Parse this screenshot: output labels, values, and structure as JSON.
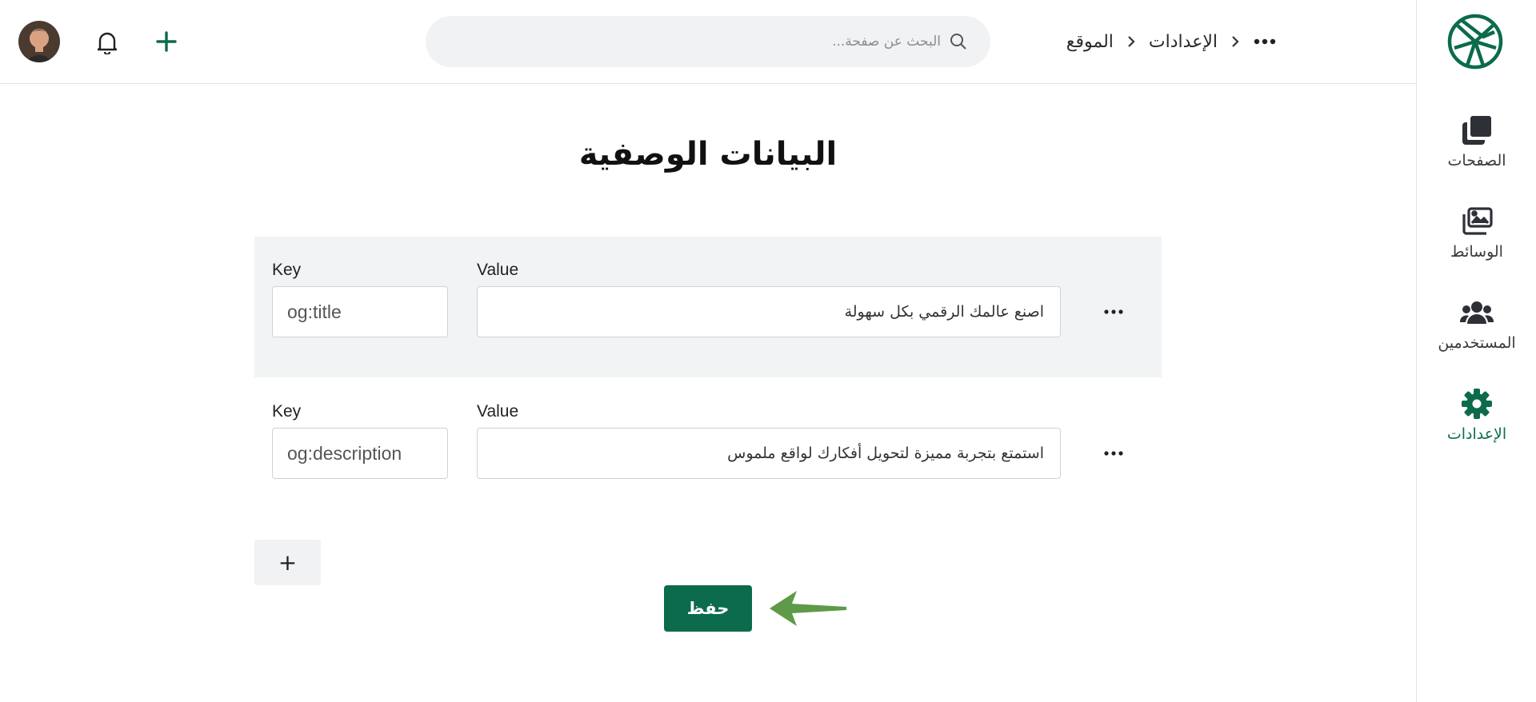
{
  "header": {
    "search_placeholder": "البحث عن صفحة...",
    "breadcrumb": [
      "الإعدادات",
      "الموقع"
    ],
    "icons": {
      "search": "search-icon",
      "bell": "bell-icon",
      "add": "plus-icon",
      "more": "more-horizontal-icon",
      "chevron": "chevron-right-icon"
    }
  },
  "sidebar": {
    "items": [
      {
        "label": "الصفحات",
        "icon": "pages-icon",
        "active": false
      },
      {
        "label": "الوسائط",
        "icon": "media-icon",
        "active": false
      },
      {
        "label": "المستخدمين",
        "icon": "users-icon",
        "active": false
      },
      {
        "label": "الإعدادات",
        "icon": "gear-icon",
        "active": true
      }
    ]
  },
  "main": {
    "title": "البيانات الوصفية",
    "rows": [
      {
        "key_label": "Key",
        "value_label": "Value",
        "key": "og:title",
        "value": "اصنع عالمك الرقمي بكل سهولة"
      },
      {
        "key_label": "Key",
        "value_label": "Value",
        "key": "og:description",
        "value": "استمتع بتجربة مميزة لتحويل أفكارك لواقع ملموس"
      }
    ],
    "add_label": "+",
    "save_label": "حفظ"
  },
  "colors": {
    "brand": "#0b6b4c",
    "row_shade": "#f2f3f5",
    "arrow": "#5e9a47"
  }
}
